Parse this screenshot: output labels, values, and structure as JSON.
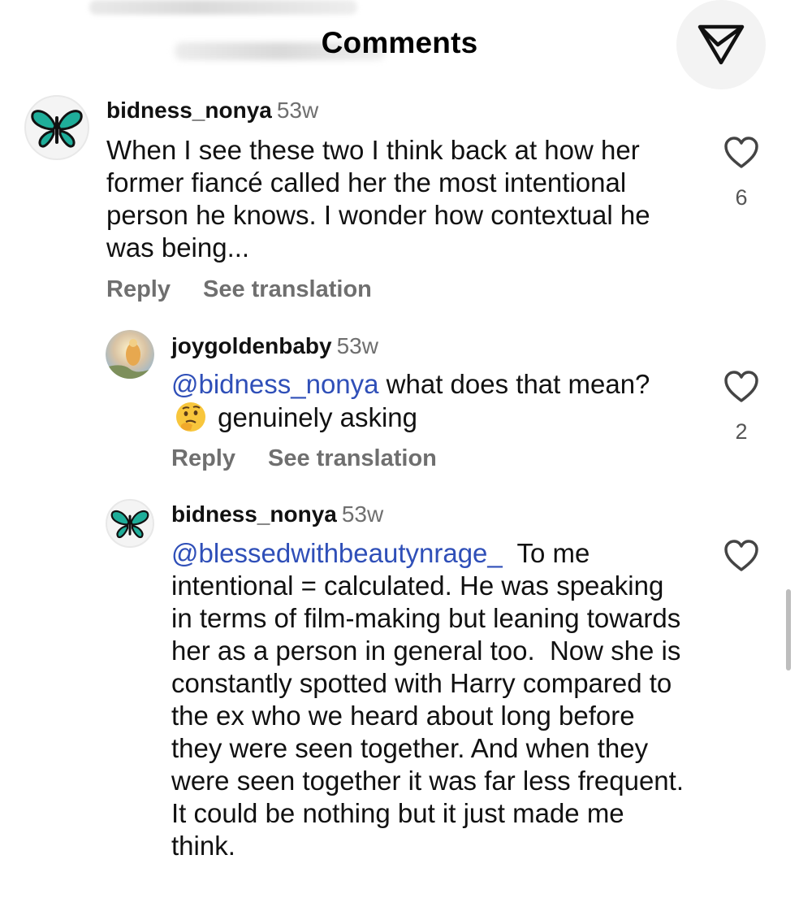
{
  "header": {
    "title": "Comments",
    "share_icon": "send-icon"
  },
  "comments": [
    {
      "username": "bidness_nonya",
      "time": "53w",
      "text": "When I see these two I think back at how her former fiancé called her the most intentional person he knows. I wonder how contextual he was being...",
      "reply_label": "Reply",
      "translate_label": "See translation",
      "likes": "6",
      "avatar_icon": "butterfly-icon"
    },
    {
      "username": "joygoldenbaby",
      "time": "53w",
      "mention": "@bidness_nonya",
      "text_before_emoji": " what does that mean?",
      "emoji": "thinking-face-emoji",
      "text_after_emoji": " genuinely asking",
      "reply_label": "Reply",
      "translate_label": "See translation",
      "likes": "2",
      "avatar_icon": "golden-photo-avatar"
    },
    {
      "username": "bidness_nonya",
      "time": "53w",
      "mention": "@blessedwithbeautynrage_",
      "text": "  To me intentional = calculated. He was speaking in terms of film-making but leaning towards her as a person in general too.  Now she is constantly spotted with Harry compared to the ex who we heard about long before they were seen together. And when they were seen together it was far less frequent. It could be nothing but it just made me think.",
      "likes": "",
      "avatar_icon": "butterfly-icon"
    }
  ]
}
